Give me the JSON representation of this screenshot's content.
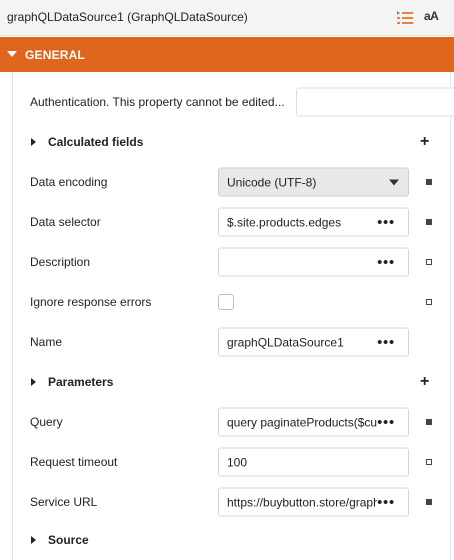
{
  "header": {
    "title": "graphQLDataSource1 (GraphQLDataSource)",
    "properties_icon": "properties-list-icon",
    "sort_icon_text": "aA"
  },
  "category": {
    "label": "GENERAL",
    "accent": "#e0661e"
  },
  "rows": {
    "authentication": {
      "label": "Authentication. This property cannot be edited..."
    },
    "calculated_fields": {
      "label": "Calculated fields"
    },
    "data_encoding": {
      "label": "Data encoding",
      "value": "Unicode (UTF-8)"
    },
    "data_selector": {
      "label": "Data selector",
      "value": "$.site.products.edges"
    },
    "description": {
      "label": "Description",
      "value": ""
    },
    "ignore_response_errors": {
      "label": "Ignore response errors",
      "checked": false
    },
    "name": {
      "label": "Name",
      "value": "graphQLDataSource1"
    },
    "parameters": {
      "label": "Parameters"
    },
    "query": {
      "label": "Query",
      "value": "query paginateProducts($cursor: String)"
    },
    "request_timeout": {
      "label": "Request timeout",
      "value": "100"
    },
    "service_url": {
      "label": "Service URL",
      "value": "https://buybutton.store/graphql"
    },
    "source": {
      "label": "Source"
    }
  },
  "icons": {
    "ellipsis": "•••",
    "plus": "+"
  }
}
